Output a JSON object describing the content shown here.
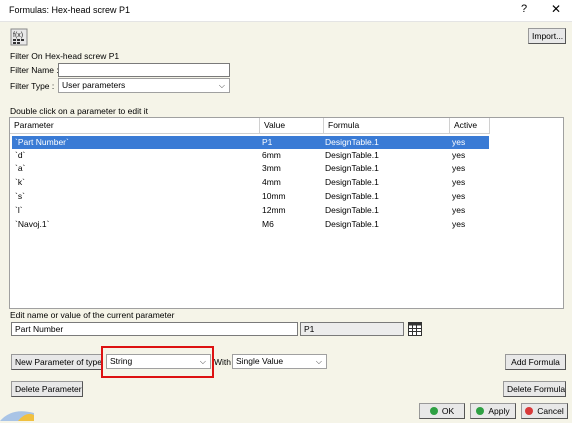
{
  "window": {
    "title": "Formulas: Hex-head screw P1",
    "help_label": "?",
    "close_label": "✕"
  },
  "toolbar": {
    "import_label": "Import..."
  },
  "filter": {
    "on_label": "Filter On Hex-head screw P1",
    "name_label": "Filter Name :",
    "name_value": "",
    "type_label": "Filter Type :",
    "type_value": "User parameters"
  },
  "table": {
    "instruction": "Double click on a parameter to edit it",
    "columns": [
      "Parameter",
      "Value",
      "Formula",
      "Active"
    ],
    "rows": [
      {
        "parameter": "`Part Number`",
        "value": "P1",
        "formula": "DesignTable.1",
        "active": "yes"
      },
      {
        "parameter": "`d`",
        "value": "6mm",
        "formula": "DesignTable.1",
        "active": "yes"
      },
      {
        "parameter": "`a`",
        "value": "3mm",
        "formula": "DesignTable.1",
        "active": "yes"
      },
      {
        "parameter": "`k`",
        "value": "4mm",
        "formula": "DesignTable.1",
        "active": "yes"
      },
      {
        "parameter": "`s`",
        "value": "10mm",
        "formula": "DesignTable.1",
        "active": "yes"
      },
      {
        "parameter": "`l`",
        "value": "12mm",
        "formula": "DesignTable.1",
        "active": "yes"
      },
      {
        "parameter": "`Navoj.1`",
        "value": "M6",
        "formula": "DesignTable.1",
        "active": "yes"
      }
    ]
  },
  "edit": {
    "label": "Edit name or value of the current parameter",
    "name_value": "Part Number",
    "value_value": "P1"
  },
  "new_param": {
    "button_label": "New Parameter of type",
    "type_value": "String",
    "with_label": "With",
    "with_value": "Single Value",
    "add_formula_label": "Add Formula"
  },
  "actions": {
    "delete_parameter_label": "Delete Parameter",
    "delete_formula_label": "Delete Formula",
    "ok_label": "OK",
    "apply_label": "Apply",
    "cancel_label": "Cancel"
  },
  "colors": {
    "selection": "#3a7bd5",
    "highlight_box": "#dd1111",
    "ok_dot": "#2ea043",
    "apply_dot": "#2ea043",
    "cancel_dot": "#d83a3a"
  }
}
